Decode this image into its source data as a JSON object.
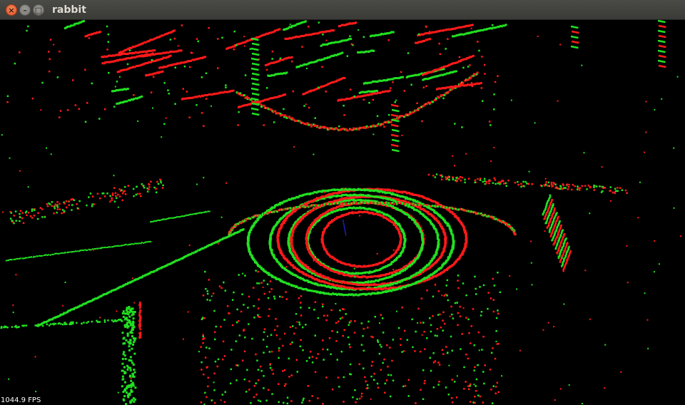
{
  "window": {
    "title": "rabbit",
    "buttons": {
      "close_glyph": "×",
      "minimize_glyph": "–",
      "maximize_glyph": "□"
    }
  },
  "viewport": {
    "fps_label": "1044.9 FPS",
    "colors": {
      "background": "#000000",
      "point_cloud_a": "#22e022",
      "point_cloud_b": "#ff1a1a",
      "origin_marker": "#2222cc"
    }
  }
}
